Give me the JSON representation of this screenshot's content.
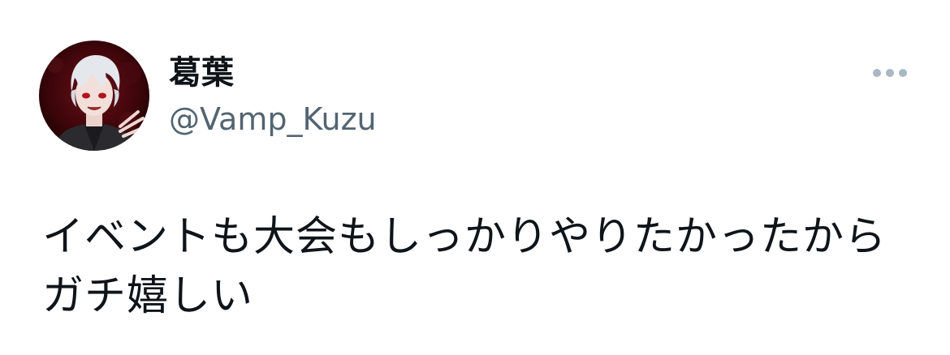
{
  "tweet": {
    "author": {
      "display_name": "葛葉",
      "handle": "@Vamp_Kuzu",
      "avatar_icon": "avatar-image"
    },
    "more_icon": "more-horizontal-icon",
    "text": "イベントも大会もしっかりやりたかったからガチ嬉しい"
  },
  "colors": {
    "text_primary": "#0f1419",
    "text_secondary": "#536471",
    "more_icon": "#aab8c2"
  }
}
